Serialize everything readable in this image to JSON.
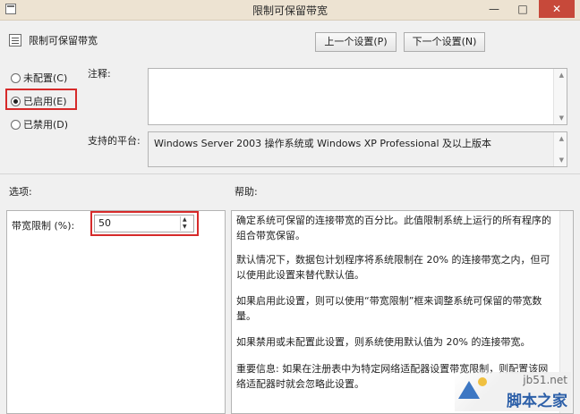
{
  "window": {
    "title": "限制可保留带宽",
    "min": "—",
    "max": "□",
    "close": "✕"
  },
  "policy": {
    "name": "限制可保留带宽"
  },
  "nav": {
    "prev_label": "上一个设置(P)",
    "next_label": "下一个设置(N)"
  },
  "state": {
    "options": [
      {
        "label": "未配置(C)",
        "selected": false
      },
      {
        "label": "已启用(E)",
        "selected": true
      },
      {
        "label": "已禁用(D)",
        "selected": false
      }
    ]
  },
  "comment": {
    "label": "注释:",
    "value": ""
  },
  "platform": {
    "label": "支持的平台:",
    "value": "Windows Server 2003 操作系统或 Windows XP Professional 及以上版本"
  },
  "options_section": {
    "label": "选项:",
    "bandwidth_label": "带宽限制 (%):",
    "bandwidth_value": "50"
  },
  "help_section": {
    "label": "帮助:",
    "paragraphs": [
      "确定系统可保留的连接带宽的百分比。此值限制系统上运行的所有程序的组合带宽保留。",
      "默认情况下，数据包计划程序将系统限制在 20% 的连接带宽之内，但可以使用此设置来替代默认值。",
      "如果启用此设置，则可以使用“带宽限制”框来调整系统可保留的带宽数量。",
      "如果禁用或未配置此设置，则系统使用默认值为 20% 的连接带宽。",
      "重要信息: 如果在注册表中为特定网络适配器设置带宽限制，则配置该网络适配器时就会忽略此设置。"
    ]
  },
  "watermark": {
    "url": "jb51.net",
    "name": "脚本之家"
  },
  "colors": {
    "highlight": "#d62a2a",
    "titlebar": "#ede3d2",
    "close": "#c7493a"
  }
}
